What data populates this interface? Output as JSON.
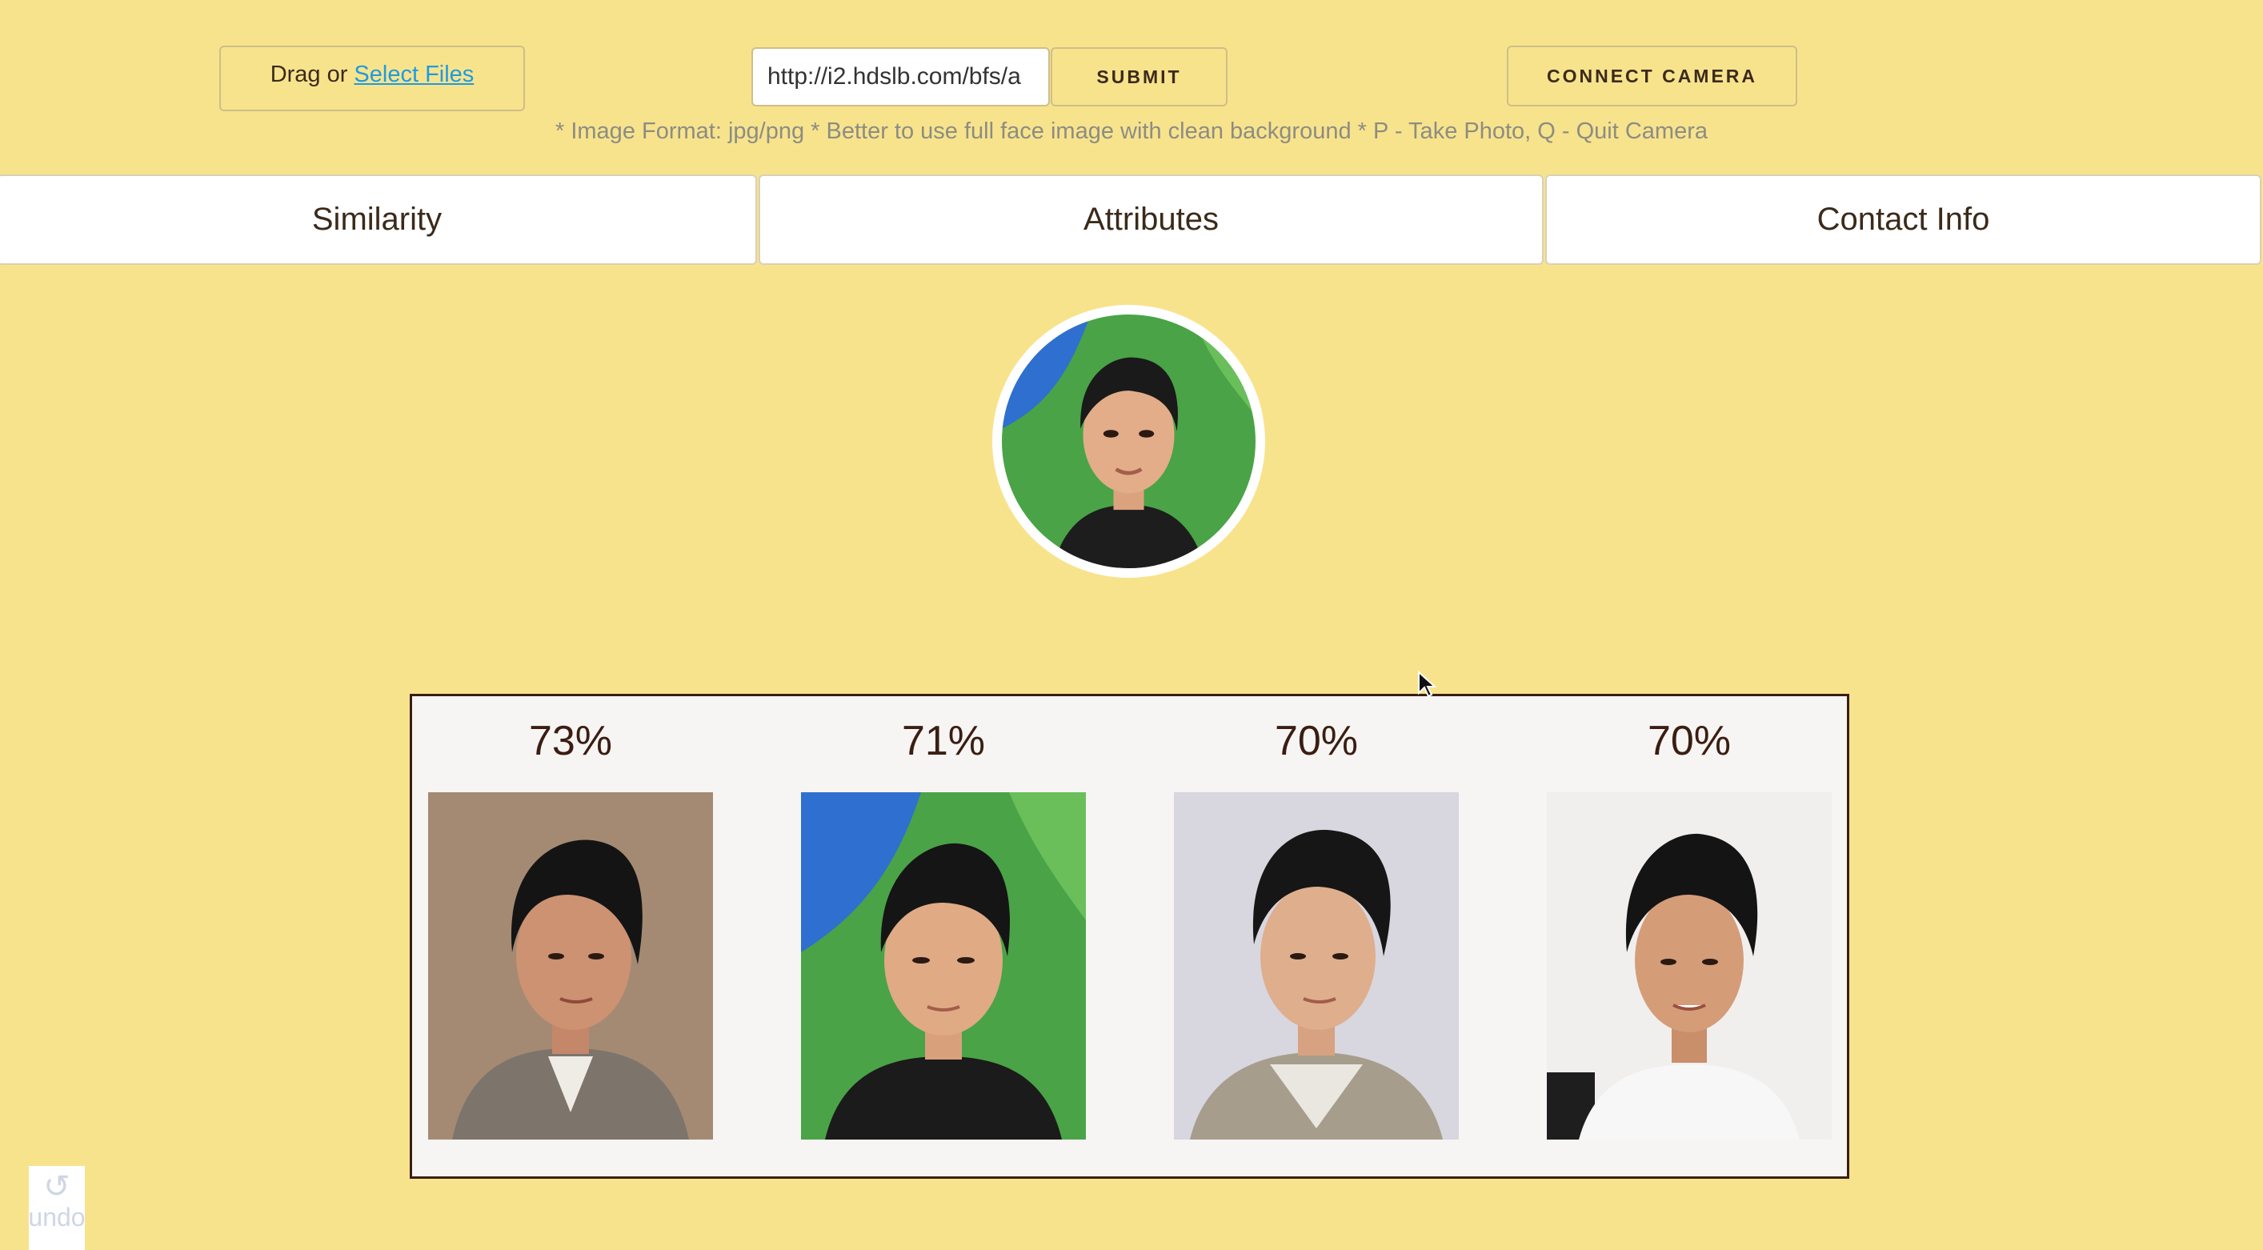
{
  "upload": {
    "drag_text": "Drag or",
    "select_files_label": "Select Files"
  },
  "url_input": {
    "value": "http://i2.hdslb.com/bfs/a"
  },
  "submit_label": "SUBMIT",
  "camera_label": "CONNECT CAMERA",
  "hint": "* Image Format: jpg/png * Better to use full face image with clean background * P - Take Photo, Q - Quit Camera",
  "tabs": [
    {
      "label": "Similarity"
    },
    {
      "label": "Attributes"
    },
    {
      "label": "Contact Info"
    }
  ],
  "matches": [
    {
      "percent": "73%"
    },
    {
      "percent": "71%"
    },
    {
      "percent": "70%"
    },
    {
      "percent": "70%"
    }
  ],
  "undo": {
    "label": "undo",
    "icon": "undo-icon"
  },
  "colors": {
    "background": "#f8e38d",
    "link": "#1e9be0",
    "frame": "#3b1d12",
    "hint": "#8c8d82"
  }
}
